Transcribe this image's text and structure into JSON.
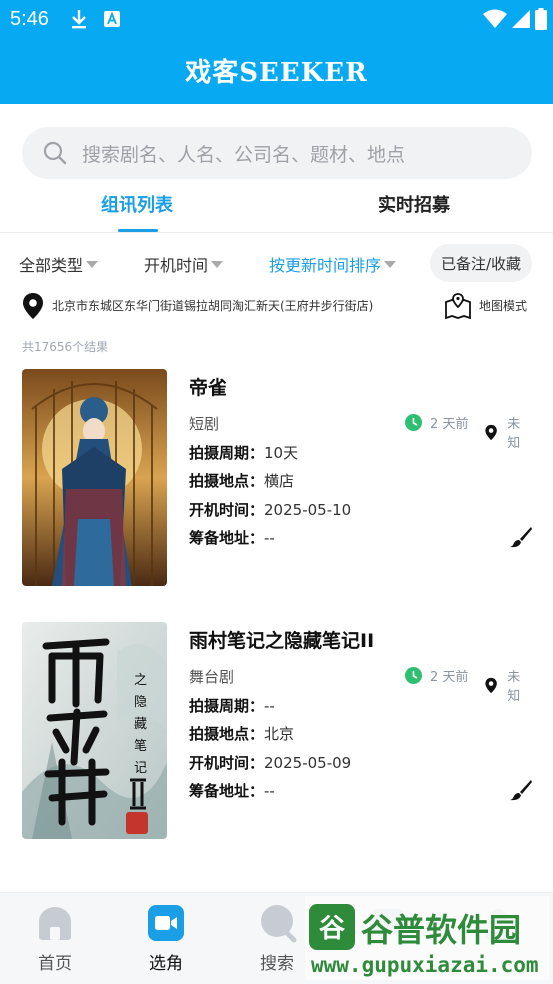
{
  "status_bar": {
    "time": "5:46"
  },
  "header": {
    "title": "戏客SEEKER"
  },
  "search": {
    "placeholder": "搜索剧名、人名、公司名、题材、地点"
  },
  "tabs": [
    {
      "label": "组讯列表",
      "active": true
    },
    {
      "label": "实时招募",
      "active": false
    }
  ],
  "filters": {
    "type": "全部类型",
    "start_time": "开机时间",
    "sort": "按更新时间排序",
    "favorites": "已备注/收藏"
  },
  "location": {
    "address": "北京市东城区东华门街道锡拉胡同淘汇新天(王府井步行街店)",
    "map_mode": "地图模式"
  },
  "result_count": "共17656个结果",
  "cards": [
    {
      "title": "帝雀",
      "genre": "短剧",
      "updated": "2 天前",
      "place_status": "未知",
      "fields": [
        {
          "label": "拍摄周期：",
          "value": "10天"
        },
        {
          "label": "拍摄地点：",
          "value": "横店"
        },
        {
          "label": "开机时间：",
          "value": "2025-05-10"
        },
        {
          "label": "筹备地址：",
          "value": "--"
        }
      ]
    },
    {
      "title": "雨村笔记之隐藏笔记II",
      "genre": "舞台剧",
      "updated": "2 天前",
      "place_status": "未知",
      "fields": [
        {
          "label": "拍摄周期：",
          "value": "--"
        },
        {
          "label": "拍摄地点：",
          "value": "北京"
        },
        {
          "label": "开机时间：",
          "value": "2025-05-09"
        },
        {
          "label": "筹备地址：",
          "value": "--"
        }
      ]
    }
  ],
  "bottom_nav": [
    {
      "label": "首页",
      "icon": "home-icon"
    },
    {
      "label": "选角",
      "icon": "video-camera-icon",
      "active": true
    },
    {
      "label": "搜索",
      "icon": "search-icon"
    }
  ],
  "watermark": {
    "line1": "谷普软件园",
    "line2": "www.gupuxiazai.com"
  },
  "colors": {
    "brand": "#07aaf2",
    "accent": "#1a9ee6",
    "clock_green": "#2fbf71"
  }
}
